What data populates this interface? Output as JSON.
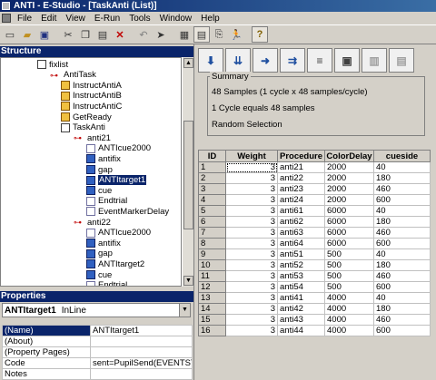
{
  "window": {
    "title": "ANTI - E-Studio - [TaskAnti  (List)]"
  },
  "menu": [
    "File",
    "Edit",
    "View",
    "E-Run",
    "Tools",
    "Window",
    "Help"
  ],
  "structure": {
    "title": "Structure",
    "items": [
      {
        "label": "fixlist",
        "icon": "list-icon",
        "indent": 40
      },
      {
        "label": "AntiTask",
        "icon": "branch-icon",
        "indent": 54
      },
      {
        "label": "InstructAntiA",
        "icon": "procedure-icon",
        "indent": 66
      },
      {
        "label": "InstructAntiB",
        "icon": "procedure-icon",
        "indent": 66
      },
      {
        "label": "InstructAntiC",
        "icon": "procedure-icon",
        "indent": 66
      },
      {
        "label": "GetReady",
        "icon": "procedure-icon",
        "indent": 66
      },
      {
        "label": "TaskAnti",
        "icon": "list-icon",
        "indent": 66
      },
      {
        "label": "anti21",
        "icon": "branch-icon",
        "indent": 80
      },
      {
        "label": "ANTIcue2000",
        "icon": "doc-icon",
        "indent": 94
      },
      {
        "label": "antifix",
        "icon": "blue-icon",
        "indent": 94
      },
      {
        "label": "gap",
        "icon": "blue-icon",
        "indent": 94
      },
      {
        "label": "ANTItarget1",
        "icon": "blue-icon",
        "indent": 94,
        "selected": true
      },
      {
        "label": "cue",
        "icon": "blue-icon",
        "indent": 94
      },
      {
        "label": "Endtrial",
        "icon": "doc-icon",
        "indent": 94
      },
      {
        "label": "EventMarkerDelay",
        "icon": "doc-icon",
        "indent": 94
      },
      {
        "label": "anti22",
        "icon": "branch-icon",
        "indent": 80
      },
      {
        "label": "ANTIcue2000",
        "icon": "doc-icon",
        "indent": 94
      },
      {
        "label": "antifix",
        "icon": "blue-icon",
        "indent": 94
      },
      {
        "label": "gap",
        "icon": "blue-icon",
        "indent": 94
      },
      {
        "label": "ANTItarget2",
        "icon": "blue-icon",
        "indent": 94
      },
      {
        "label": "cue",
        "icon": "blue-icon",
        "indent": 94
      },
      {
        "label": "Endtrial",
        "icon": "doc-icon",
        "indent": 94
      }
    ]
  },
  "properties": {
    "title": "Properties",
    "object_name": "ANTItarget1",
    "object_type": "InLine",
    "rows": [
      {
        "key": "(Name)",
        "value": "ANTItarget1",
        "selected": true
      },
      {
        "key": "(About)",
        "value": ""
      },
      {
        "key": "(Property Pages)",
        "value": ""
      },
      {
        "key": "Code",
        "value": "sent=PupilSend(EVENTSTR"
      },
      {
        "key": "Notes",
        "value": ""
      }
    ]
  },
  "summary": {
    "legend": "Summary",
    "line1": "48 Samples (1 cycle x 48 samples/cycle)",
    "line2": "1 Cycle equals 48 samples",
    "line3": "Random Selection"
  },
  "grid": {
    "headers": [
      "ID",
      "Weight",
      "Procedure",
      "ColorDelay",
      "cueside"
    ],
    "rows": [
      [
        "1",
        "3",
        "anti21",
        "2000",
        "40"
      ],
      [
        "2",
        "3",
        "anti22",
        "2000",
        "180"
      ],
      [
        "3",
        "3",
        "anti23",
        "2000",
        "460"
      ],
      [
        "4",
        "3",
        "anti24",
        "2000",
        "600"
      ],
      [
        "5",
        "3",
        "anti61",
        "6000",
        "40"
      ],
      [
        "6",
        "3",
        "anti62",
        "6000",
        "180"
      ],
      [
        "7",
        "3",
        "anti63",
        "6000",
        "460"
      ],
      [
        "8",
        "3",
        "anti64",
        "6000",
        "600"
      ],
      [
        "9",
        "3",
        "anti51",
        "500",
        "40"
      ],
      [
        "10",
        "3",
        "anti52",
        "500",
        "180"
      ],
      [
        "11",
        "3",
        "anti53",
        "500",
        "460"
      ],
      [
        "12",
        "3",
        "anti54",
        "500",
        "600"
      ],
      [
        "13",
        "3",
        "anti41",
        "4000",
        "40"
      ],
      [
        "14",
        "3",
        "anti42",
        "4000",
        "180"
      ],
      [
        "15",
        "3",
        "anti43",
        "4000",
        "460"
      ],
      [
        "16",
        "3",
        "anti44",
        "4000",
        "600"
      ]
    ]
  }
}
